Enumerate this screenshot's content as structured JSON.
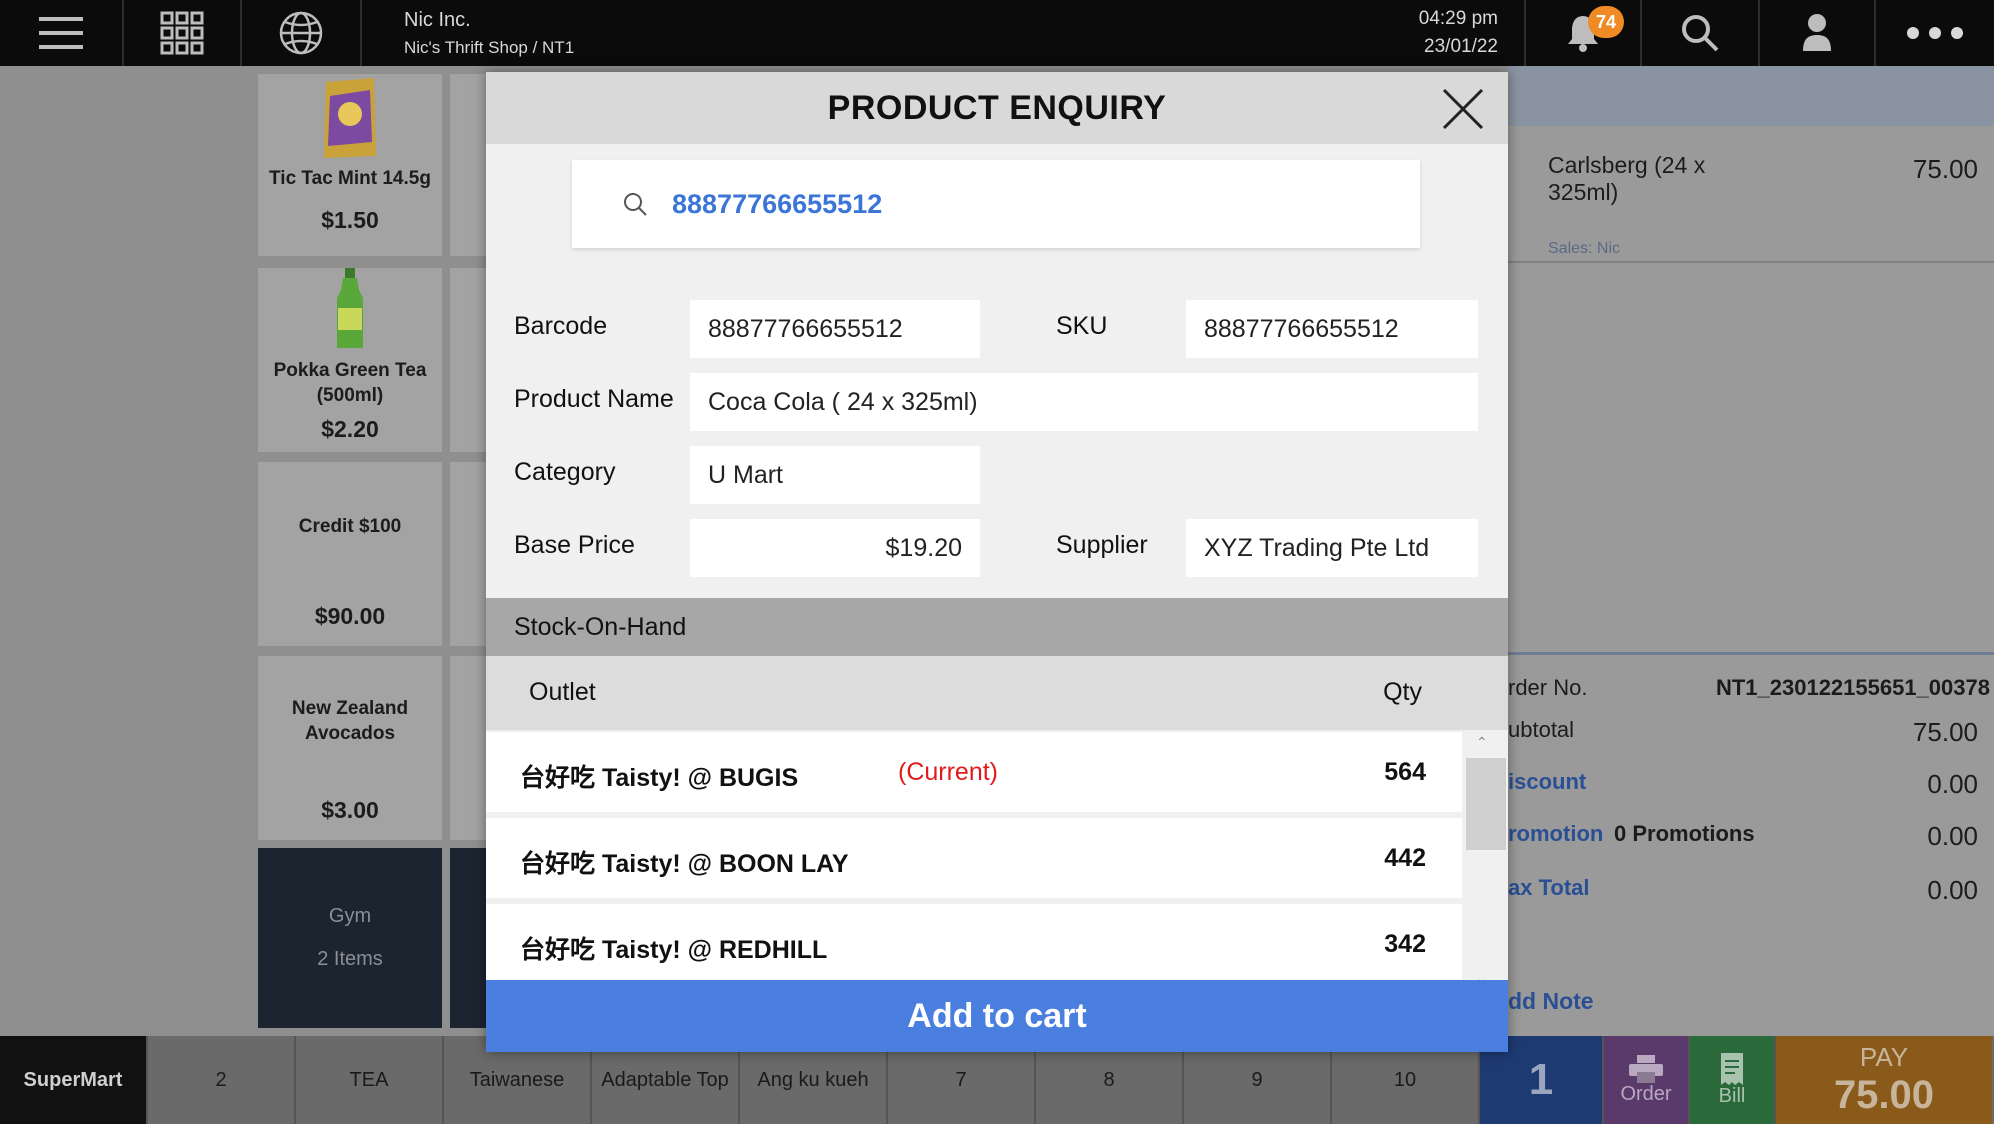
{
  "header": {
    "company": "Nic Inc.",
    "shop": "Nic's Thrift Shop / NT1",
    "time": "04:29 pm",
    "date": "23/01/22",
    "notification_count": "74"
  },
  "products": [
    {
      "name": "Tic Tac Mint 14.5g",
      "price": "$1.50"
    },
    {
      "name": "Pokka Green Tea (500ml)",
      "price": "$2.20"
    },
    {
      "name": "Credit $100",
      "price": "$90.00"
    },
    {
      "name": "New Zealand Avocados",
      "price": "$3.00"
    },
    {
      "name": "Gym",
      "sub": "2 Items"
    }
  ],
  "cart": {
    "item_name": "Carlsberg (24 x 325ml)",
    "item_price": "75.00",
    "item_sales": "Sales: Nic",
    "order_no_label": "rder No.",
    "order_no": "NT1_230122155651_00378",
    "subtotal_label": "ubtotal",
    "subtotal": "75.00",
    "discount_label": "iscount",
    "discount": "0.00",
    "promotion_label": "romotion",
    "promotion_count": "0 Promotions",
    "promotion": "0.00",
    "tax_label": "ax Total",
    "tax": "0.00",
    "add_note": "dd Note"
  },
  "bottom": {
    "brand": "SuperMart",
    "tabs": [
      "2",
      "TEA",
      "Taiwanese",
      "Adaptable Top",
      "Ang ku kueh",
      "7",
      "8",
      "9",
      "10"
    ],
    "qty": "1",
    "order": "Order",
    "bill": "Bill",
    "pay_label": "PAY",
    "pay_amount": "75.00"
  },
  "modal": {
    "title": "PRODUCT ENQUIRY",
    "search_value": "88877766655512",
    "fields": {
      "barcode_label": "Barcode",
      "barcode": "88877766655512",
      "sku_label": "SKU",
      "sku": "88877766655512",
      "product_name_label": "Product Name",
      "product_name": "Coca Cola ( 24 x 325ml)",
      "category_label": "Category",
      "category": "U Mart",
      "base_price_label": "Base Price",
      "base_price": "$19.20",
      "supplier_label": "Supplier",
      "supplier": "XYZ Trading Pte Ltd"
    },
    "stock_title": "Stock-On-Hand",
    "col_outlet": "Outlet",
    "col_qty": "Qty",
    "stock": [
      {
        "outlet": "台好吃 Taisty! @ BUGIS",
        "tag": "(Current)",
        "qty": "564"
      },
      {
        "outlet": "台好吃 Taisty! @ BOON LAY",
        "tag": "",
        "qty": "442"
      },
      {
        "outlet": "台好吃 Taisty! @ REDHILL",
        "tag": "",
        "qty": "342"
      }
    ],
    "add_to_cart": "Add to cart"
  },
  "colors": {
    "accent": "#4a7fe0",
    "current_tag": "#e11b1b",
    "notification_badge": "#f08a24"
  }
}
